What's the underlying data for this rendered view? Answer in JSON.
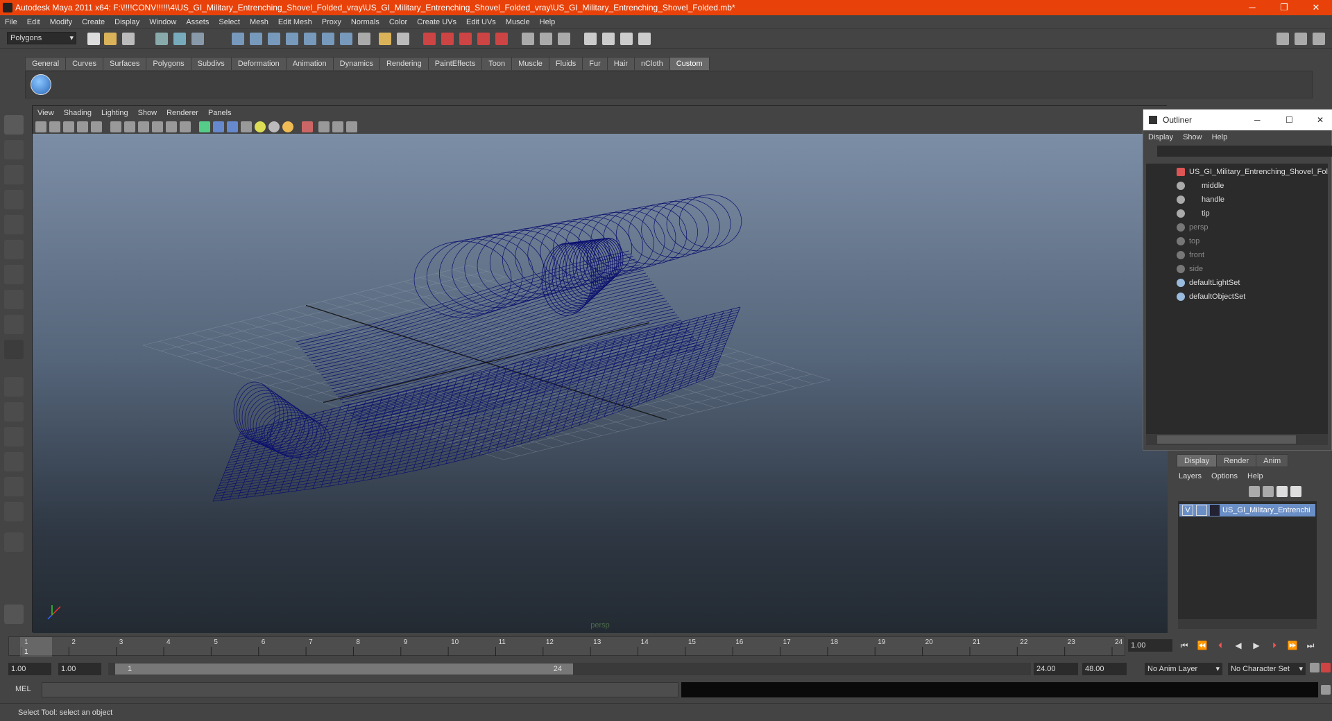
{
  "window": {
    "title": "Autodesk Maya 2011 x64: F:\\!!!!CONV!!!!!\\4\\US_GI_Military_Entrenching_Shovel_Folded_vray\\US_GI_Military_Entrenching_Shovel_Folded_vray\\US_GI_Military_Entrenching_Shovel_Folded.mb*",
    "minimize": "─",
    "restore": "❐",
    "close": "✕"
  },
  "menubar": [
    "File",
    "Edit",
    "Modify",
    "Create",
    "Display",
    "Window",
    "Assets",
    "Select",
    "Mesh",
    "Edit Mesh",
    "Proxy",
    "Normals",
    "Color",
    "Create UVs",
    "Edit UVs",
    "Muscle",
    "Help"
  ],
  "toolbar": {
    "mode": "Polygons"
  },
  "shelf": {
    "tabs": [
      "General",
      "Curves",
      "Surfaces",
      "Polygons",
      "Subdivs",
      "Deformation",
      "Animation",
      "Dynamics",
      "Rendering",
      "PaintEffects",
      "Toon",
      "Muscle",
      "Fluids",
      "Fur",
      "Hair",
      "nCloth",
      "Custom"
    ],
    "active": "Custom"
  },
  "viewport": {
    "menu": [
      "View",
      "Shading",
      "Lighting",
      "Show",
      "Renderer",
      "Panels"
    ],
    "camera_label": "persp",
    "wire_color": "#0b0f6e"
  },
  "outliner": {
    "title": "Outliner",
    "menu": [
      "Display",
      "Show",
      "Help"
    ],
    "items": [
      {
        "label": "US_GI_Military_Entrenching_Shovel_Fol",
        "indent": 0,
        "dim": false
      },
      {
        "label": "middle",
        "indent": 1,
        "dim": false
      },
      {
        "label": "handle",
        "indent": 1,
        "dim": false
      },
      {
        "label": "tip",
        "indent": 1,
        "dim": false
      },
      {
        "label": "persp",
        "indent": 0,
        "dim": true
      },
      {
        "label": "top",
        "indent": 0,
        "dim": true
      },
      {
        "label": "front",
        "indent": 0,
        "dim": true
      },
      {
        "label": "side",
        "indent": 0,
        "dim": true
      },
      {
        "label": "defaultLightSet",
        "indent": 0,
        "dim": false
      },
      {
        "label": "defaultObjectSet",
        "indent": 0,
        "dim": false
      }
    ]
  },
  "layers": {
    "tabs": [
      "Display",
      "Render",
      "Anim"
    ],
    "active": "Display",
    "menu": [
      "Layers",
      "Options",
      "Help"
    ],
    "row": {
      "visible": "V",
      "name": "US_GI_Military_Entrenchi"
    }
  },
  "timeslider": {
    "ticks": [
      "1",
      "2",
      "3",
      "4",
      "5",
      "6",
      "7",
      "8",
      "9",
      "10",
      "11",
      "12",
      "13",
      "14",
      "15",
      "16",
      "17",
      "18",
      "19",
      "20",
      "21",
      "22",
      "23",
      "24"
    ],
    "current_frame": "1.00",
    "first_marker": "1"
  },
  "range": {
    "start": "1.00",
    "anim_start": "1.00",
    "range_start_label": "1",
    "range_end_label": "24",
    "end": "24.00",
    "anim_end": "48.00",
    "anim_layer": "No Anim Layer",
    "char_set": "No Character Set"
  },
  "cmdline": {
    "label": "MEL"
  },
  "help_text": "Select Tool: select an object"
}
